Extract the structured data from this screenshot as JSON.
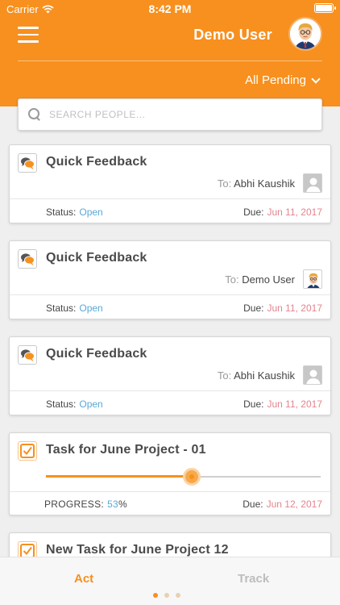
{
  "status_bar": {
    "carrier": "Carrier",
    "time": "8:42 PM"
  },
  "header": {
    "user_name": "Demo User",
    "filter_label": "All Pending"
  },
  "search": {
    "placeholder": "SEARCH PEOPLE..."
  },
  "colors": {
    "accent": "#f7901e",
    "status_open": "#5aa8d6",
    "due": "#e5838d"
  },
  "cards": [
    {
      "type": "feedback",
      "icon": "chat-bubbles-icon",
      "title": "Quick Feedback",
      "to_label": "To:",
      "to_name": "Abhi Kaushik",
      "avatar": "generic-person-avatar",
      "status_label": "Status:",
      "status_value": "Open",
      "due_label": "Due:",
      "due_value": "Jun 11, 2017"
    },
    {
      "type": "feedback",
      "icon": "chat-bubbles-icon",
      "title": "Quick Feedback",
      "to_label": "To:",
      "to_name": "Demo User",
      "avatar": "demo-user-avatar",
      "status_label": "Status:",
      "status_value": "Open",
      "due_label": "Due:",
      "due_value": "Jun 11, 2017"
    },
    {
      "type": "feedback",
      "icon": "chat-bubbles-icon",
      "title": "Quick Feedback",
      "to_label": "To:",
      "to_name": "Abhi Kaushik",
      "avatar": "generic-person-avatar",
      "status_label": "Status:",
      "status_value": "Open",
      "due_label": "Due:",
      "due_value": "Jun 11, 2017"
    },
    {
      "type": "task",
      "icon": "checkbox-icon",
      "title": "Task for June Project - 01",
      "progress_label": "PROGRESS:",
      "progress_value": "53",
      "progress_unit": "%",
      "progress_fraction": 0.53,
      "due_label": "Due:",
      "due_value": "Jun 12, 2017"
    },
    {
      "type": "task",
      "icon": "checkbox-icon",
      "title": "New Task for June Project 12"
    }
  ],
  "tabbar": {
    "tabs": [
      {
        "label": "Act",
        "active": true
      },
      {
        "label": "Track",
        "active": false
      }
    ],
    "page_count": 3,
    "active_page": 0
  }
}
